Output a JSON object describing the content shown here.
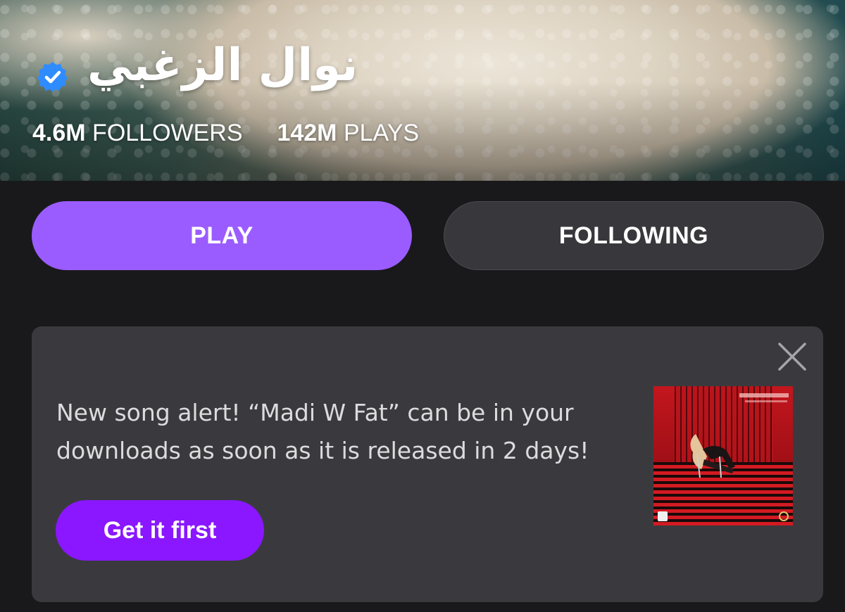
{
  "artist": {
    "name": "نوال الزغبي",
    "verified": true,
    "followers_count": "4.6M",
    "followers_label": "FOLLOWERS",
    "plays_count": "142M",
    "plays_label": "PLAYS"
  },
  "actions": {
    "play_label": "PLAY",
    "following_label": "FOLLOWING"
  },
  "alert": {
    "message": "New song alert! “Madi W Fat” can be in your downloads as soon as it is released in 2 days!",
    "cta_label": "Get it first"
  },
  "icons": {
    "verified": "verified-badge-icon",
    "close": "close-icon"
  },
  "colors": {
    "background": "#19191c",
    "play_button": "#9b5cff",
    "following_button": "#38383c",
    "card": "#3a3a3e",
    "cta_button": "#8a17ff",
    "verified_badge": "#2f8cff"
  }
}
